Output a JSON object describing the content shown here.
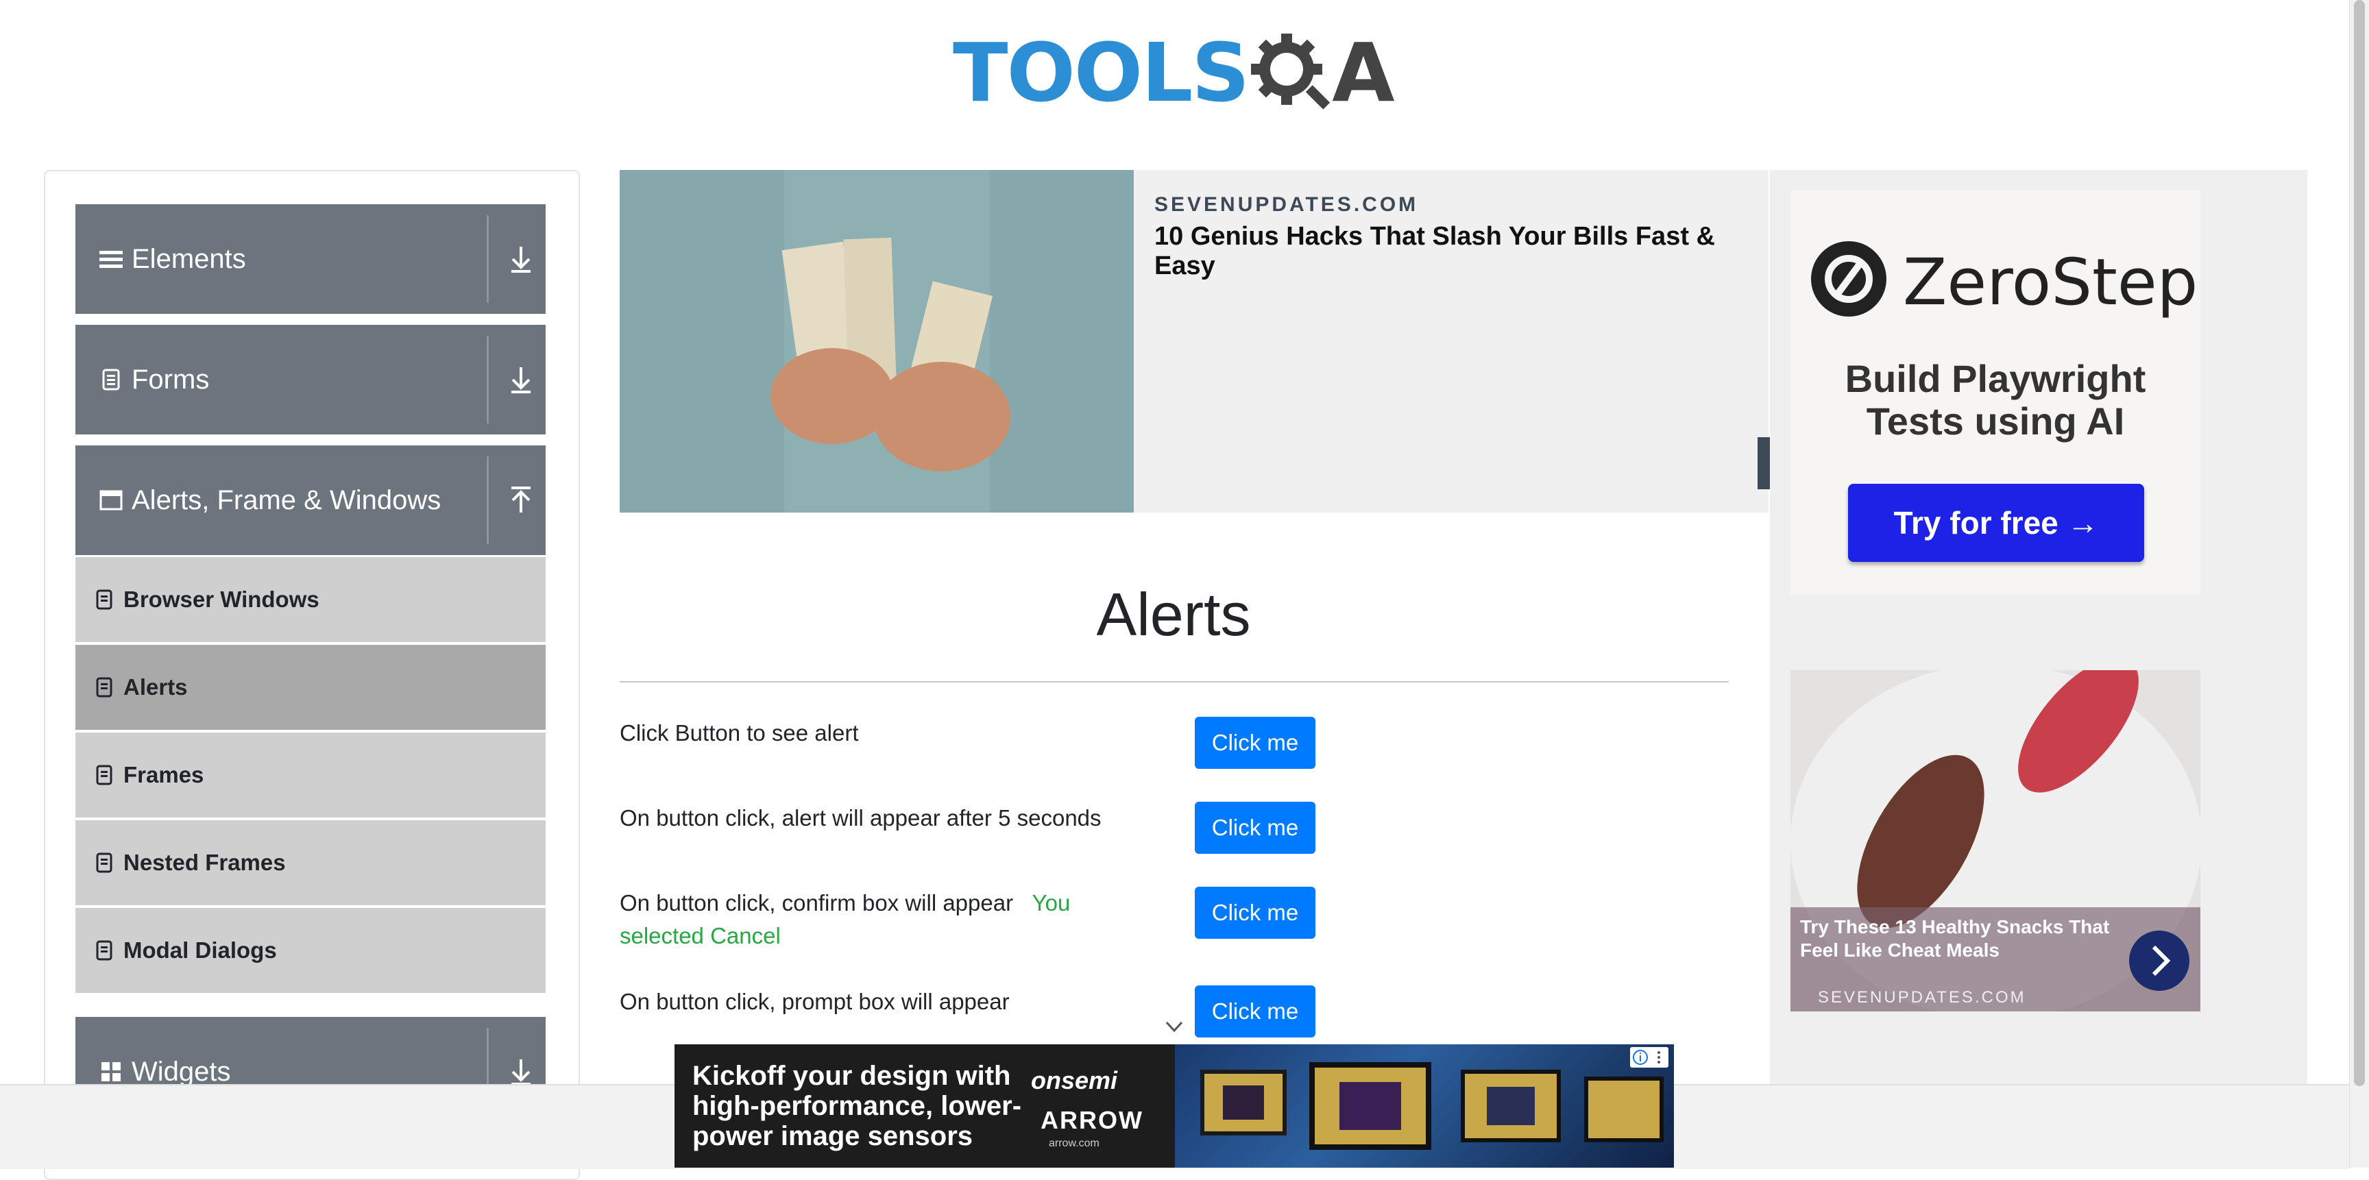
{
  "header": {
    "logo_tools": "TOOLS",
    "logo_qa": "A"
  },
  "sidebar": {
    "groups": [
      {
        "label": "Elements",
        "icon": "hamburger-icon",
        "expanded": false
      },
      {
        "label": "Forms",
        "icon": "document-icon",
        "expanded": false
      },
      {
        "label": "Alerts, Frame & Windows",
        "icon": "window-icon",
        "expanded": true
      },
      {
        "label": "Widgets",
        "icon": "grid-icon",
        "expanded": false
      }
    ],
    "items": [
      {
        "label": "Browser Windows",
        "active": false
      },
      {
        "label": "Alerts",
        "active": true
      },
      {
        "label": "Frames",
        "active": false
      },
      {
        "label": "Nested Frames",
        "active": false
      },
      {
        "label": "Modal Dialogs",
        "active": false
      }
    ]
  },
  "top_ad": {
    "source": "SEVENUPDATES.COM",
    "headline": "10 Genius Hacks That Slash Your Bills Fast & Easy"
  },
  "right_ad": {
    "brand": "ZeroStep",
    "tagline_line1": "Build Playwright",
    "tagline_line2": "Tests using AI",
    "cta": "Try for free →",
    "snack_caption": "Try These 13 Healthy Snacks That Feel Like Cheat Meals",
    "snack_source": "SEVENUPDATES.COM"
  },
  "main": {
    "title": "Alerts",
    "rows": [
      {
        "label": "Click Button to see alert",
        "button": "Click me"
      },
      {
        "label": "On button click, alert will appear after 5 seconds",
        "button": "Click me"
      },
      {
        "label": "On button click, confirm box will appear",
        "result": "You selected Cancel",
        "button": "Click me"
      },
      {
        "label": "On button click, prompt box will appear",
        "button": "Click me"
      }
    ]
  },
  "bottom_ad": {
    "text": "Kickoff your design with high-performance, lower-power image sensors",
    "brand1": "onsemi",
    "brand2": "ARROW",
    "brand3": "arrow.com"
  },
  "colors": {
    "sidebar_group": "#6c757d",
    "sidebar_item": "#cfcfcf",
    "sidebar_item_active": "#a9a9a9",
    "primary_button": "#007bff",
    "result_text": "#28a745"
  }
}
